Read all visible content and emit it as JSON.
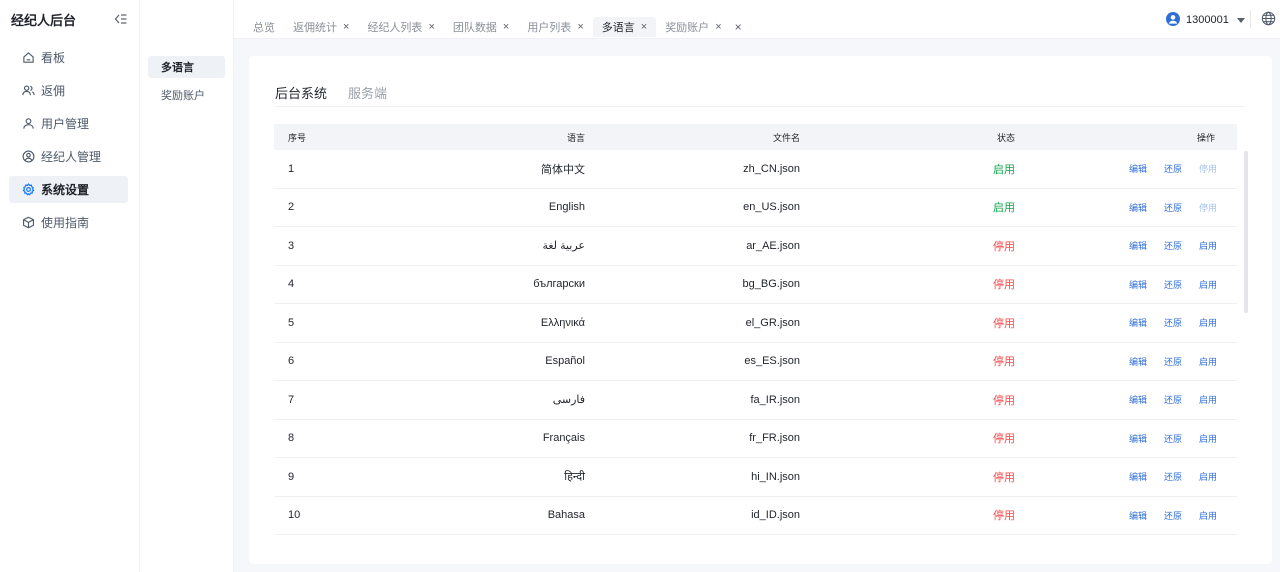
{
  "sidebar": {
    "title": "经纪人后台",
    "items": [
      {
        "label": "看板",
        "icon": "home-icon"
      },
      {
        "label": "返佣",
        "icon": "users-icon"
      },
      {
        "label": "用户管理",
        "icon": "user-icon"
      },
      {
        "label": "经纪人管理",
        "icon": "user-circle-icon"
      },
      {
        "label": "系统设置",
        "icon": "gear-icon",
        "active": true
      },
      {
        "label": "使用指南",
        "icon": "box-icon"
      }
    ]
  },
  "subnav": {
    "items": [
      {
        "label": "多语言",
        "active": true
      },
      {
        "label": "奖励账户"
      }
    ]
  },
  "tabbar": {
    "tabs": [
      {
        "label": "总览",
        "closable": false
      },
      {
        "label": "返佣统计",
        "closable": true
      },
      {
        "label": "经纪人列表",
        "closable": true
      },
      {
        "label": "团队数据",
        "closable": true
      },
      {
        "label": "用户列表",
        "closable": true
      },
      {
        "label": "多语言",
        "closable": true,
        "active": true
      },
      {
        "label": "奖励账户",
        "closable": true
      }
    ],
    "close_symbol": "×",
    "close_all_symbol": "×"
  },
  "user": {
    "name": "1300001",
    "icon": "user-avatar-icon"
  },
  "content": {
    "tabs": [
      {
        "label": "后台系统",
        "active": true
      },
      {
        "label": "服务端"
      }
    ],
    "table": {
      "headers": {
        "index": "序号",
        "language": "语言",
        "file": "文件名",
        "status": "状态",
        "ops": "操作"
      },
      "ops_labels": {
        "edit": "编辑",
        "restore": "还原",
        "enable": "启用",
        "disable": "停用"
      },
      "rows": [
        {
          "index": "1",
          "language": "简体中文",
          "file": "zh_CN.json",
          "status": "启用",
          "enabled": true
        },
        {
          "index": "2",
          "language": "English",
          "file": "en_US.json",
          "status": "启用",
          "enabled": true
        },
        {
          "index": "3",
          "language": "عربية لغة",
          "file": "ar_AE.json",
          "status": "停用",
          "enabled": false
        },
        {
          "index": "4",
          "language": "български",
          "file": "bg_BG.json",
          "status": "停用",
          "enabled": false
        },
        {
          "index": "5",
          "language": "Ελληνικά",
          "file": "el_GR.json",
          "status": "停用",
          "enabled": false
        },
        {
          "index": "6",
          "language": "Español",
          "file": "es_ES.json",
          "status": "停用",
          "enabled": false
        },
        {
          "index": "7",
          "language": "فارسی",
          "file": "fa_IR.json",
          "status": "停用",
          "enabled": false
        },
        {
          "index": "8",
          "language": "Français",
          "file": "fr_FR.json",
          "status": "停用",
          "enabled": false
        },
        {
          "index": "9",
          "language": "हिन्दी",
          "file": "hi_IN.json",
          "status": "停用",
          "enabled": false
        },
        {
          "index": "10",
          "language": "Bahasa",
          "file": "id_ID.json",
          "status": "停用",
          "enabled": false
        }
      ]
    }
  },
  "colors": {
    "accent": "#1677ff",
    "enabled": "#14a44d",
    "disabled": "#f5484a",
    "link": "#2f6ed8"
  }
}
